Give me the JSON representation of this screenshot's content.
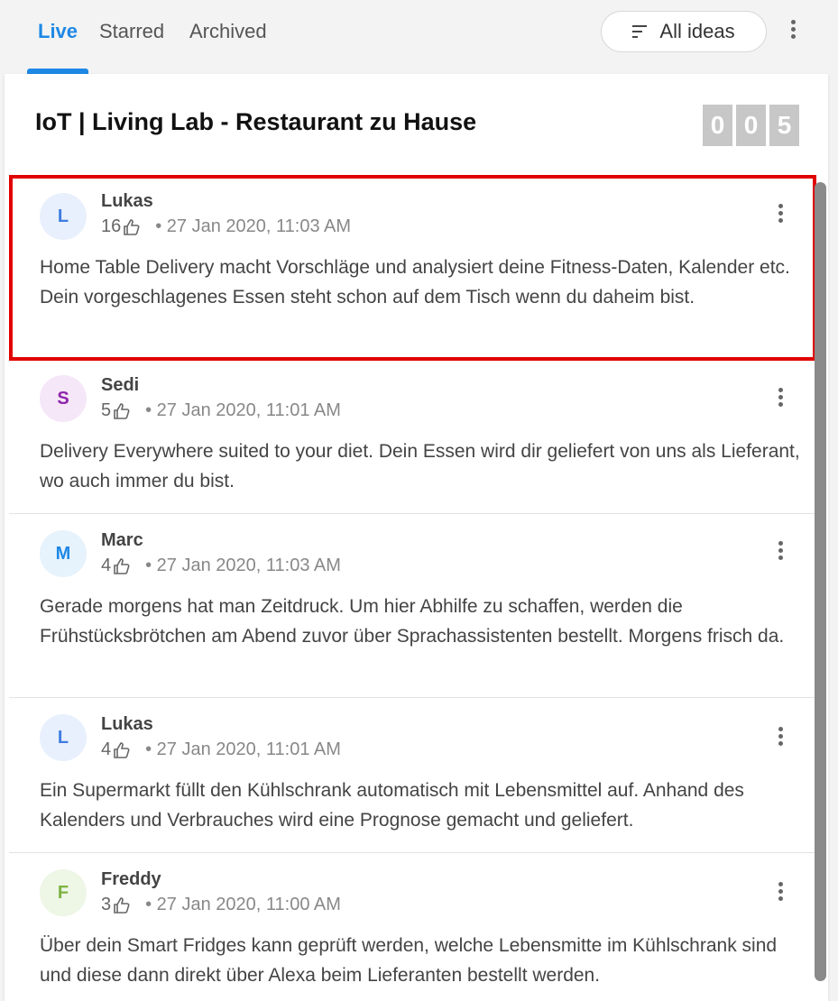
{
  "tabs": [
    {
      "label": "Live",
      "active": true
    },
    {
      "label": "Starred",
      "active": false
    },
    {
      "label": "Archived",
      "active": false
    }
  ],
  "filter": {
    "label": "All ideas",
    "icon": "sort-lines-icon"
  },
  "board": {
    "title": "IoT | Living Lab - Restaurant zu Hause",
    "counter": [
      "0",
      "0",
      "5"
    ]
  },
  "ideas": [
    {
      "initial": "L",
      "author": "Lukas",
      "likes": "16",
      "date": "• 27 Jan 2020, 11:03 AM",
      "text": "Home Table Delivery macht Vorschläge und analysiert deine Fitness-Daten, Kalender etc. Dein vorgeschlagenes Essen steht schon auf dem Tisch wenn du daheim bist.",
      "avatar_color": "#3f7ce0",
      "avatar_bg": "#e8f0fd",
      "highlighted": true
    },
    {
      "initial": "S",
      "author": "Sedi",
      "likes": "5",
      "date": "• 27 Jan 2020, 11:01 AM",
      "text": "Delivery Everywhere suited to your diet. Dein Essen wird dir geliefert von uns als Lieferant, wo auch immer du bist.",
      "avatar_color": "#8e24aa",
      "avatar_bg": "#f5e6f8"
    },
    {
      "initial": "M",
      "author": "Marc",
      "likes": "4",
      "date": "• 27 Jan 2020, 11:03 AM",
      "text": "Gerade morgens hat man Zeitdruck. Um hier Abhilfe zu schaffen, werden die Frühstücksbrötchen am Abend zuvor über Sprachassistenten bestellt. Morgens frisch da.",
      "avatar_color": "#1e88e5",
      "avatar_bg": "#e6f2fc"
    },
    {
      "initial": "L",
      "author": "Lukas",
      "likes": "4",
      "date": "• 27 Jan 2020, 11:01 AM",
      "text": "Ein Supermarkt füllt den Kühlschrank automatisch mit Lebensmittel auf. Anhand des Kalenders und Verbrauches wird eine Prognose gemacht und geliefert.",
      "avatar_color": "#3f7ce0",
      "avatar_bg": "#e8f0fd"
    },
    {
      "initial": "F",
      "author": "Freddy",
      "likes": "3",
      "date": "• 27 Jan 2020, 11:00 AM",
      "text": "Über dein Smart Fridges kann geprüft werden, welche Lebensmitte im Kühlschrank sind und diese dann direkt über Alexa beim Lieferanten bestellt werden.",
      "avatar_color": "#7cb342",
      "avatar_bg": "#eef6e6"
    }
  ],
  "colors": {
    "accent": "#1e88e5",
    "highlight": "#e00000"
  }
}
